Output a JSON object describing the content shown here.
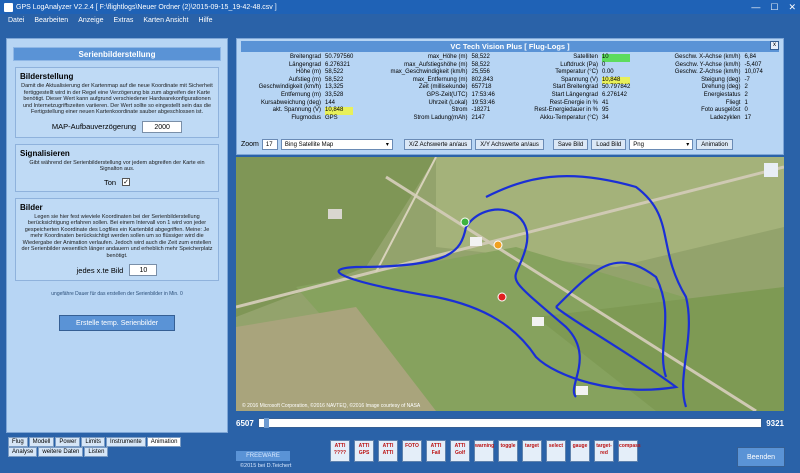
{
  "window": {
    "title": "GPS LogAnalyzer V2.2.4    [ F:\\flightlogs\\Neuer Ordner (2)\\2015-09-15_19-42-48.csv ]",
    "controls": [
      "—",
      "☐",
      "✕"
    ]
  },
  "menu": [
    "Datei",
    "Bearbeiten",
    "Anzeige",
    "Extras",
    "Karten Ansicht",
    "Hilfe"
  ],
  "left": {
    "title": "Serienbilderstellung",
    "bilderstellung": {
      "heading": "Bilderstellung",
      "desc": "Damit die Aktualisierung der Kartenmap auf die neue Koordinate mit Sicherheit fertiggestellt wird in der Regel eine Verzögerung bis zum abgreifen der Karte benötigt. Dieser Wert kann aufgrund verschiedener Hardwarekonfigurationen und Internetzugriffszeiten variieren. Der Wert sollte so eingestellt sein das die Fertigstellung einer neuen Kartenkoordinate sauber abgeschlossen ist.",
      "label": "MAP-Aufbauverzögerung",
      "value": "2000"
    },
    "signal": {
      "heading": "Signalisieren",
      "desc": "Gibt während der Serienbilderstellung vor jedem abgreifen der Karte ein Signalton aus.",
      "label": "Ton",
      "check": "✓"
    },
    "bilder": {
      "heading": "Bilder",
      "desc": "Legen sie hier fest wieviele Koordinaten bei der Serienbilderstellung berücksichtigung erfahren sollen. Bei einem Intervall von 1 wird von jeder gespeicherten Koordinate des Logfiles ein Kartenbild abgegriffen. Meine: Je mehr Koordinaten berücksichtigt werden sollen um so flüssiger wird die Wiedergabe der Animation verlaufen. Jedoch wird auch die Zeit zum erstellen der Serienbilder wesentlich länger andauern und erheblich mehr Speicherplatz benötigt.",
      "label": "jedes x.te Bild",
      "value": "10"
    },
    "duration": "ungefähre Dauer für das erstellen der Serienbilder in Min. 0",
    "create_btn": "Erstelle temp. Serienbilder",
    "tabs_row1": [
      "Flug",
      "Modell",
      "Power",
      "Limits",
      "Instrumente",
      "Animation"
    ],
    "tabs_row2": [
      "Analyse",
      "weitere Daten",
      "Listen"
    ]
  },
  "right": {
    "title": "VC Tech Vision Plus [ Flug-Logs ]",
    "close": "x",
    "col1": {
      "labels": [
        "Breitengrad",
        "Längengrad",
        "Höhe (m)",
        "Aufstieg (m)",
        "Geschwindigkeit (km/h)",
        "Entfernung (m)",
        "Kursabweichung (deg)",
        "akt. Spannung (V)",
        "Flugmodus"
      ],
      "values": [
        "50.797560",
        "6.276321",
        "58,522",
        "58,522",
        "13,325",
        "33,528",
        "144",
        "10,848",
        "GPS"
      ]
    },
    "col2": {
      "labels": [
        "max_Höhe (m)",
        "max_Aufstiegshöhe (m)",
        "max_Geschwindigkeit (km/h)",
        "max_Entfernung (m)",
        "Zeit (millisekunde)",
        "GPS-Zeit(UTC)",
        "Uhrzeit (Lokal)",
        "Strom",
        "Strom Ladung(mAh)"
      ],
      "values": [
        "58,522",
        "58,522",
        "25,556",
        "802,843",
        "657718",
        "17:53:46",
        "19:53:46",
        "-18271",
        "2147"
      ]
    },
    "col3": {
      "labels": [
        "Satelliten",
        "Luftdruck (Pa)",
        "Temperatur (°C)",
        "Spannung (V)",
        "Start Breitengrad",
        "Start Längengrad",
        "Rest-Energie in %",
        "Rest-Energiedauer in %",
        "Akku-Temperatur (°C)"
      ],
      "values": [
        "10",
        "0",
        "0.00",
        "10,848",
        "50.797842",
        "6.276142",
        "41",
        "95",
        "34"
      ]
    },
    "col4": {
      "labels": [
        "Geschw. X-Achse (km/h)",
        "Geschw. Y-Achse (km/h)",
        "Geschw. Z-Achse (km/h)",
        "Steigung (deg)",
        "Drehung (deg)",
        "Energiestatus",
        "Fliegt",
        "Foto ausgelöst",
        "Ladezyklen"
      ],
      "values": [
        "6,84",
        "-5,407",
        "10,074",
        "-7",
        "2",
        "2",
        "1",
        "0",
        "17"
      ]
    },
    "toolbar": {
      "zoom_label": "Zoom",
      "zoom_value": "17",
      "map_type": "Bing Satellite Map",
      "xz": "X/Z Achswerte an/aus",
      "xy": "X/Y Achswerte an/aus",
      "save": "Save Bild",
      "load": "Load Bild",
      "format": "Png",
      "animation": "Animation"
    }
  },
  "map": {
    "attribution": "© 2016 Microsoft Corporation, ©2016 NAVTEQ, ©2016 Image courtesy of NASA",
    "track_color": "#1a2fd6"
  },
  "slider": {
    "min": "6507",
    "max": "9321",
    "position": 0.01
  },
  "bottom": {
    "freeware": "FREEWARE",
    "copyright": "©2015  bei D.Teichert",
    "icons": [
      "ATTI\n????",
      "ATTI\nGPS",
      "ATTI\nATTI",
      "FOTO",
      "ATTI\nFail",
      "ATTI\nGolf",
      "warning",
      "toggle",
      "target",
      "select",
      "gauge",
      "target-red",
      "compass"
    ],
    "beenden": "Beenden"
  }
}
